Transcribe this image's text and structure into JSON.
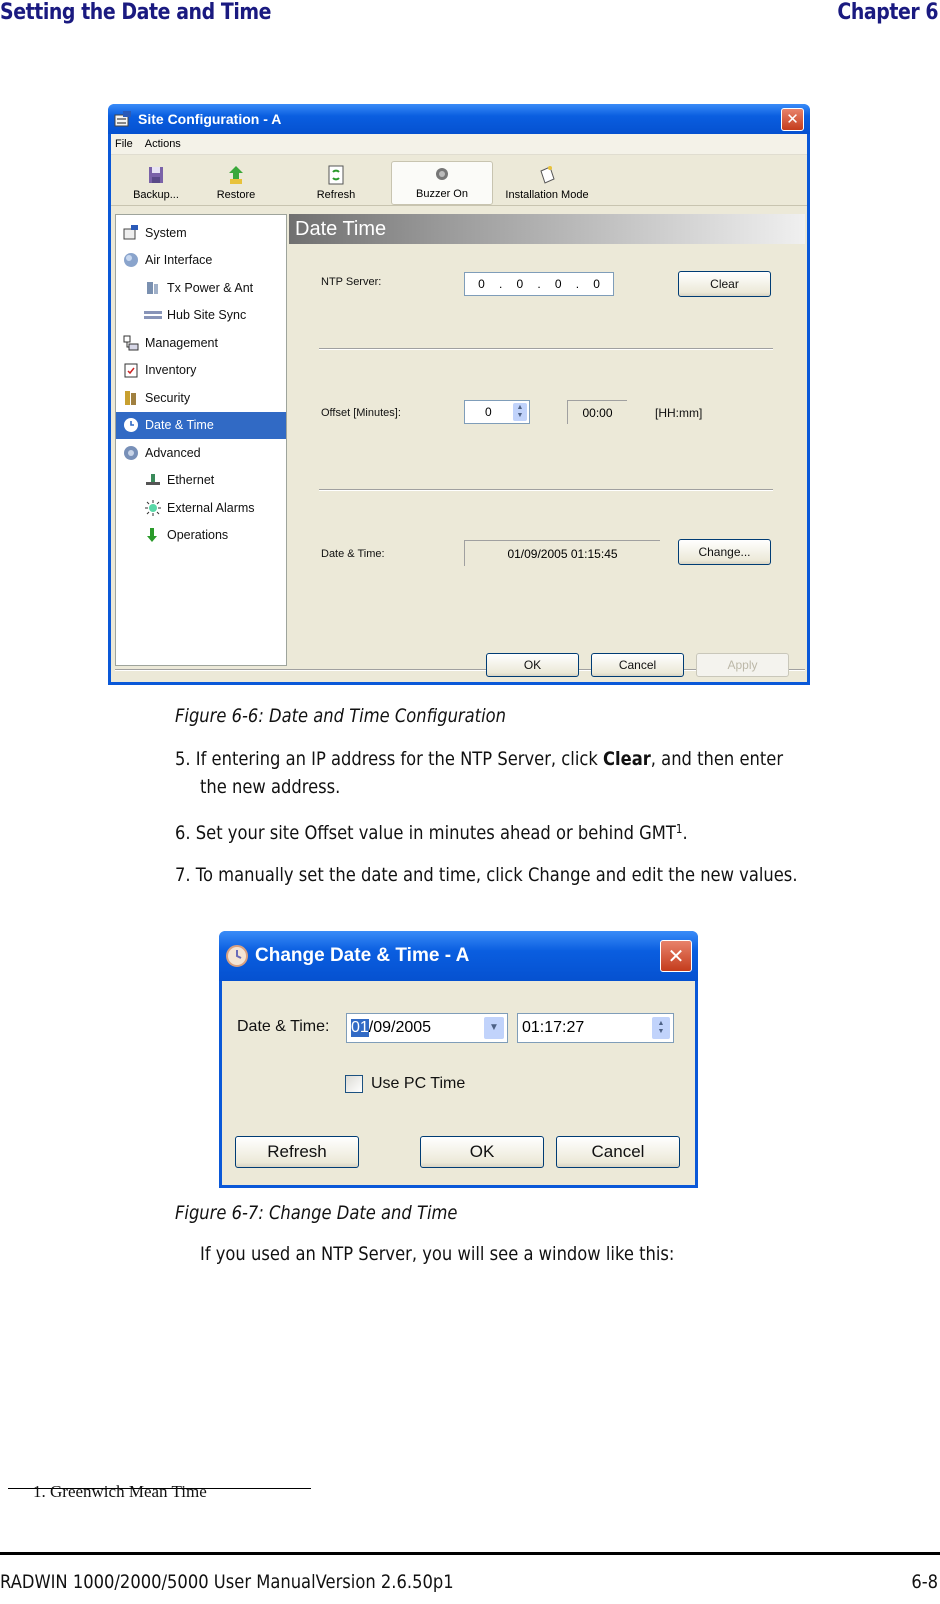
{
  "page_header": {
    "section_title": "Setting the Date and Time",
    "chapter": "Chapter 6"
  },
  "site_config_window": {
    "title": "Site Configuration - A",
    "menu": [
      "File",
      "Actions"
    ],
    "toolbar": [
      {
        "label": "Backup...",
        "icon": "floppy-disk-icon"
      },
      {
        "label": "Restore",
        "icon": "restore-arrow-icon"
      },
      {
        "label": "Refresh",
        "icon": "refresh-icon"
      },
      {
        "label": "Buzzer On",
        "icon": "buzzer-icon",
        "pressed": true
      },
      {
        "label": "Installation Mode",
        "icon": "installation-mode-icon"
      }
    ],
    "tree": [
      {
        "label": "System",
        "icon": "system-icon",
        "level": 0
      },
      {
        "label": "Air Interface",
        "icon": "air-interface-icon",
        "level": 0
      },
      {
        "label": "Tx Power & Ant",
        "icon": "antenna-icon",
        "level": 1
      },
      {
        "label": "Hub Site Sync",
        "icon": "hub-sync-icon",
        "level": 1
      },
      {
        "label": "Management",
        "icon": "management-icon",
        "level": 0
      },
      {
        "label": "Inventory",
        "icon": "inventory-icon",
        "level": 0
      },
      {
        "label": "Security",
        "icon": "security-keys-icon",
        "level": 0
      },
      {
        "label": "Date & Time",
        "icon": "clock-icon",
        "level": 0,
        "selected": true
      },
      {
        "label": "Advanced",
        "icon": "advanced-gear-icon",
        "level": 0
      },
      {
        "label": "Ethernet",
        "icon": "ethernet-icon",
        "level": 1
      },
      {
        "label": "External Alarms",
        "icon": "alarm-icon",
        "level": 1
      },
      {
        "label": "Operations",
        "icon": "operations-arrow-icon",
        "level": 1
      }
    ],
    "panel": {
      "title": "Date  Time",
      "ntp_label": "NTP Server:",
      "ntp_octets": [
        "0",
        "0",
        "0",
        "0"
      ],
      "clear_button": "Clear",
      "offset_label": "Offset [Minutes]:",
      "offset_value": "0",
      "offset_hhmm": "00:00",
      "offset_unit": "[HH:mm]",
      "datetime_label": "Date & Time:",
      "datetime_value": "01/09/2005 01:15:45",
      "change_button": "Change..."
    },
    "buttons": {
      "ok": "OK",
      "cancel": "Cancel",
      "apply": "Apply"
    }
  },
  "figure1_caption": "Figure 6-6: Date and Time Configuration",
  "steps": {
    "step5_prefix": "5. If entering an IP address for the NTP Server, click ",
    "step5_bold": "Clear",
    "step5_suffix": ", and then enter",
    "step5_line2": "the new address.",
    "step6": "6. Set your site Offset value in minutes ahead or behind GMT",
    "step6_sup": "1",
    "step6_end": ".",
    "step7": "7. To manually set the date and time, click Change and edit the new values."
  },
  "change_dialog": {
    "title": "Change Date & Time - A",
    "datetime_label": "Date & Time:",
    "date_highlight": "01",
    "date_rest": "/09/2005",
    "time_value": "01:17:27",
    "use_pc_time_label": "Use PC Time",
    "use_pc_time_checked": false,
    "buttons": {
      "refresh": "Refresh",
      "ok": "OK",
      "cancel": "Cancel"
    }
  },
  "figure2_caption": "Figure 6-7: Change Date and Time",
  "ntp_note": "If you used an NTP Server, you will see a window like this:",
  "footnote": "1.  Greenwich Mean Time",
  "footer": {
    "manual": "RADWIN 1000/2000/5000 User ManualVersion  2.6.50p1",
    "page": "6-8"
  }
}
